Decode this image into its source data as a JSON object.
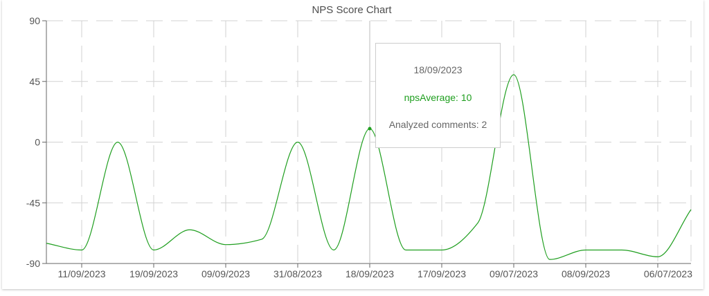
{
  "chart_data": {
    "type": "line",
    "title": "NPS Score Chart",
    "x": [
      "11/09/2023",
      "19/09/2023",
      "09/09/2023",
      "31/08/2023",
      "18/09/2023",
      "17/09/2023",
      "09/07/2023",
      "08/09/2023",
      "06/07/2023"
    ],
    "ylim": [
      -90,
      90
    ],
    "yticks": [
      90,
      45,
      0,
      -45,
      -90
    ],
    "series": [
      {
        "color": "#1e9e1e",
        "points": [
          [
            -0.5,
            -75
          ],
          [
            0,
            -80
          ],
          [
            0.5,
            0
          ],
          [
            1,
            -80
          ],
          [
            1.5,
            -65
          ],
          [
            2,
            -76
          ],
          [
            2.5,
            -72
          ],
          [
            3,
            0
          ],
          [
            3.5,
            -80
          ],
          [
            4,
            10
          ],
          [
            4.5,
            -80
          ],
          [
            5,
            -80
          ],
          [
            5.5,
            -60
          ],
          [
            6,
            50
          ],
          [
            6.5,
            -87
          ],
          [
            7,
            -80
          ],
          [
            7.5,
            -80
          ],
          [
            8,
            -85
          ],
          [
            8.5,
            -50
          ]
        ]
      }
    ],
    "grid": true,
    "highlight_index": 4
  },
  "tooltip": {
    "date": "18/09/2023",
    "nps_text": "npsAverage: 10",
    "comments_text": "Analyzed comments: 2"
  }
}
